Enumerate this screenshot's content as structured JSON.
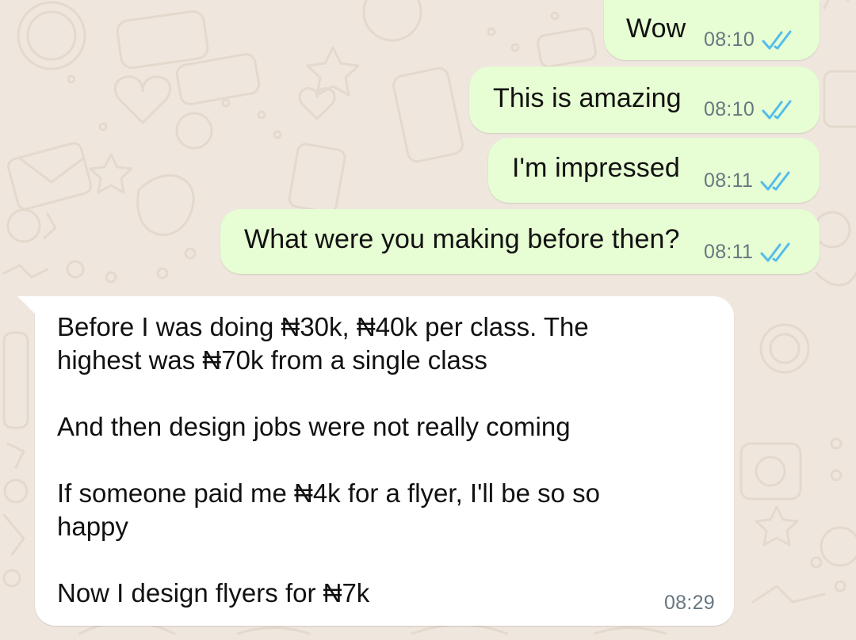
{
  "conversation": {
    "outgoing": [
      {
        "text": "Wow",
        "time": "08:10",
        "status": "read-double-tick"
      },
      {
        "text": "This is amazing",
        "time": "08:10",
        "status": "read-double-tick"
      },
      {
        "text": "I'm impressed",
        "time": "08:11",
        "status": "read-double-tick"
      },
      {
        "text": "What were you making before then?",
        "time": "08:11",
        "status": "read-double-tick"
      }
    ],
    "incoming": {
      "text": "Before I was doing ₦30k, ₦40k per class. The\nhighest was ₦70k from a single class\n\nAnd then design jobs were not really coming\n\nIf someone paid me ₦4k for a flyer, I'll be so so\nhappy\n\nNow I design flyers for ₦7k",
      "time": "08:29"
    }
  },
  "colors": {
    "wallpaper": "#efe7de",
    "outgoing_bubble": "#e7fdd3",
    "incoming_bubble": "#ffffff",
    "read_tick": "#53bdeb",
    "timestamp": "#667781"
  }
}
